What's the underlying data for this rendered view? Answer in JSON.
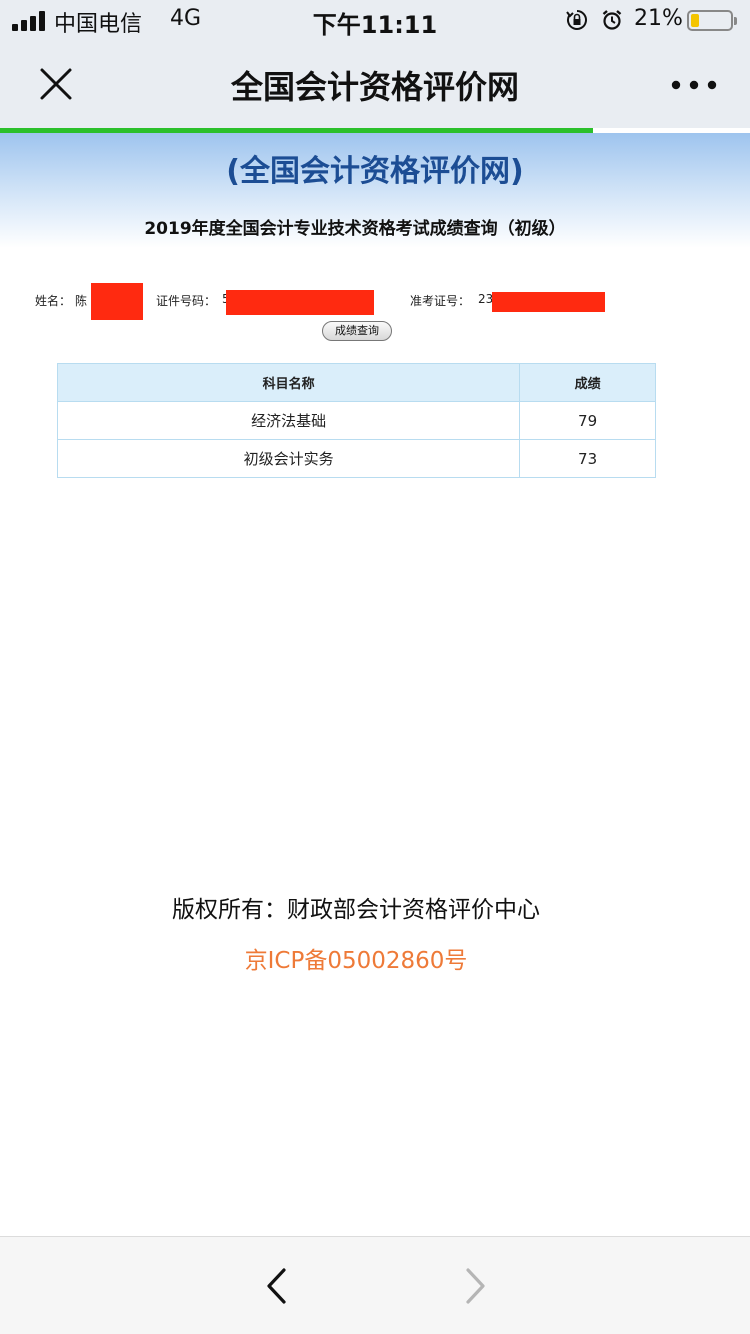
{
  "status_bar": {
    "carrier": "中国电信",
    "network": "4G",
    "time": "下午11:11",
    "battery_percent": "21%",
    "battery_level": 0.21,
    "battery_color": "#f4c400"
  },
  "nav": {
    "title": "全国会计资格评价网",
    "close_icon": "close-icon",
    "more_icon": "more-icon",
    "load_progress": 0.79,
    "progress_color": "#2bc02b"
  },
  "header": {
    "site_subtitle": "(全国会计资格评价网)",
    "heading": "2019年度全国会计专业技术资格考试成绩查询（初级）"
  },
  "query": {
    "name_label": "姓名：",
    "name_value": "陈",
    "id_label": "证件号码：",
    "id_value": "5",
    "ticket_label": "准考证号：",
    "ticket_value": "23",
    "redaction_color": "#ff2a10",
    "button_label": "成绩查询"
  },
  "results": {
    "headers": [
      "科目名称",
      "成绩"
    ],
    "rows": [
      [
        "经济法基础",
        "79"
      ],
      [
        "初级会计实务",
        "73"
      ]
    ]
  },
  "footer": {
    "copyright": "版权所有：财政部会计资格评价中心",
    "icp": "京ICP备05002860号",
    "icp_color": "#ee7a38"
  },
  "toolbar": {
    "back_icon": "chevron-left-icon",
    "forward_icon": "chevron-right-icon"
  }
}
